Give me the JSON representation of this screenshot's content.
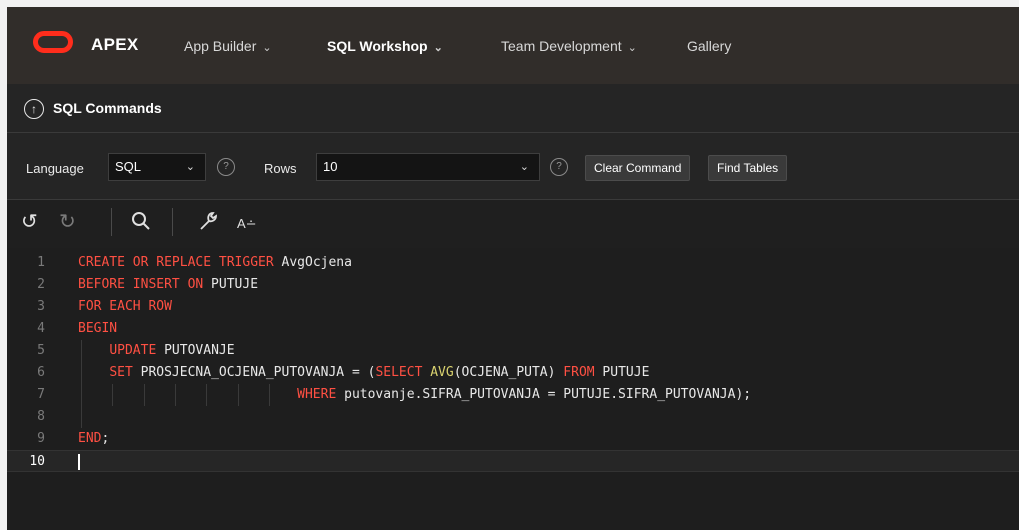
{
  "header": {
    "brand": "APEX",
    "nav": [
      {
        "label": "App Builder",
        "active": false
      },
      {
        "label": "SQL Workshop",
        "active": true
      },
      {
        "label": "Team Development",
        "active": false
      },
      {
        "label": "Gallery",
        "active": false
      }
    ]
  },
  "page": {
    "title": "SQL Commands"
  },
  "toolbar": {
    "language_label": "Language",
    "language_value": "SQL",
    "rows_label": "Rows",
    "rows_value": "10",
    "help_glyph": "?",
    "clear_command": "Clear Command",
    "find_tables": "Find Tables"
  },
  "editor_tools": {
    "format_label": "A∸"
  },
  "editor": {
    "current_line": 10,
    "lines": [
      {
        "n": "1",
        "tokens": [
          {
            "t": "CREATE OR REPLACE ",
            "c": "kw"
          },
          {
            "t": "TRIGGER",
            "c": "kw"
          },
          {
            "t": " AvgOcjena",
            "c": ""
          }
        ]
      },
      {
        "n": "2",
        "tokens": [
          {
            "t": "BEFORE INSERT ON",
            "c": "kw"
          },
          {
            "t": " PUTUJE",
            "c": ""
          }
        ]
      },
      {
        "n": "3",
        "tokens": [
          {
            "t": "FOR EACH ROW",
            "c": "kw"
          }
        ]
      },
      {
        "n": "4",
        "tokens": [
          {
            "t": "BEGIN",
            "c": "kw"
          }
        ]
      },
      {
        "n": "5",
        "tokens": [
          {
            "t": "    ",
            "c": ""
          },
          {
            "t": "UPDATE",
            "c": "kw"
          },
          {
            "t": " PUTOVANJE",
            "c": ""
          }
        ]
      },
      {
        "n": "6",
        "tokens": [
          {
            "t": "    ",
            "c": ""
          },
          {
            "t": "SET",
            "c": "kw"
          },
          {
            "t": " PROSJECNA_OCJENA_PUTOVANJA = (",
            "c": ""
          },
          {
            "t": "SELECT",
            "c": "kw"
          },
          {
            "t": " ",
            "c": ""
          },
          {
            "t": "AVG",
            "c": "fn"
          },
          {
            "t": "(OCJENA_PUTA) ",
            "c": ""
          },
          {
            "t": "FROM",
            "c": "kw"
          },
          {
            "t": " PUTUJE",
            "c": ""
          }
        ]
      },
      {
        "n": "7",
        "tokens": [
          {
            "t": "                            ",
            "c": ""
          },
          {
            "t": "WHERE",
            "c": "kw"
          },
          {
            "t": " putovanje.SIFRA_PUTOVANJA = PUTUJE.SIFRA_PUTOVANJA);",
            "c": ""
          }
        ]
      },
      {
        "n": "8",
        "tokens": []
      },
      {
        "n": "9",
        "tokens": [
          {
            "t": "END",
            "c": "kw"
          },
          {
            "t": ";",
            "c": ""
          }
        ]
      },
      {
        "n": "10",
        "tokens": []
      }
    ]
  }
}
